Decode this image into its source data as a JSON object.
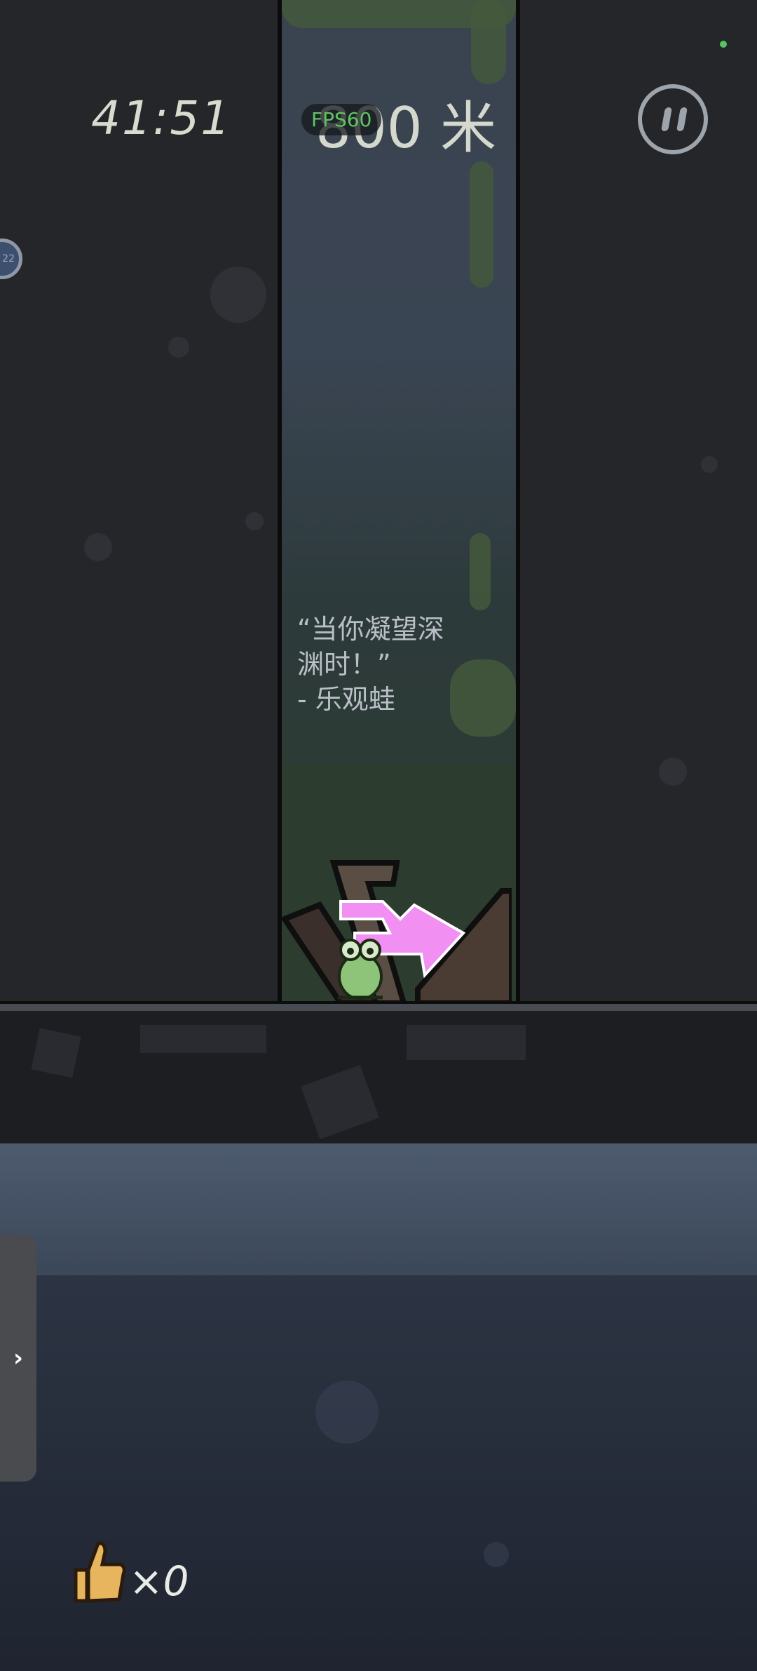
{
  "hud": {
    "timer": "41:51",
    "depth": "800 米",
    "fps": "FPS60"
  },
  "side_bubble": {
    "label": "22"
  },
  "quote": {
    "line1": "“当你凝望深",
    "line2": "渊时！”",
    "line3": " - 乐观蛙"
  },
  "drawer": {
    "arrow": "›"
  },
  "likes": {
    "count": "×0"
  },
  "icons": {
    "pause": "pause-icon",
    "arrow": "direction-arrow-icon",
    "frog": "frog-character",
    "like": "thumbs-up-icon"
  },
  "colors": {
    "arrow": "#f28ff2",
    "fps_text": "#61c35f",
    "frog": "#8ec47a",
    "status_dot": "#57c464"
  }
}
